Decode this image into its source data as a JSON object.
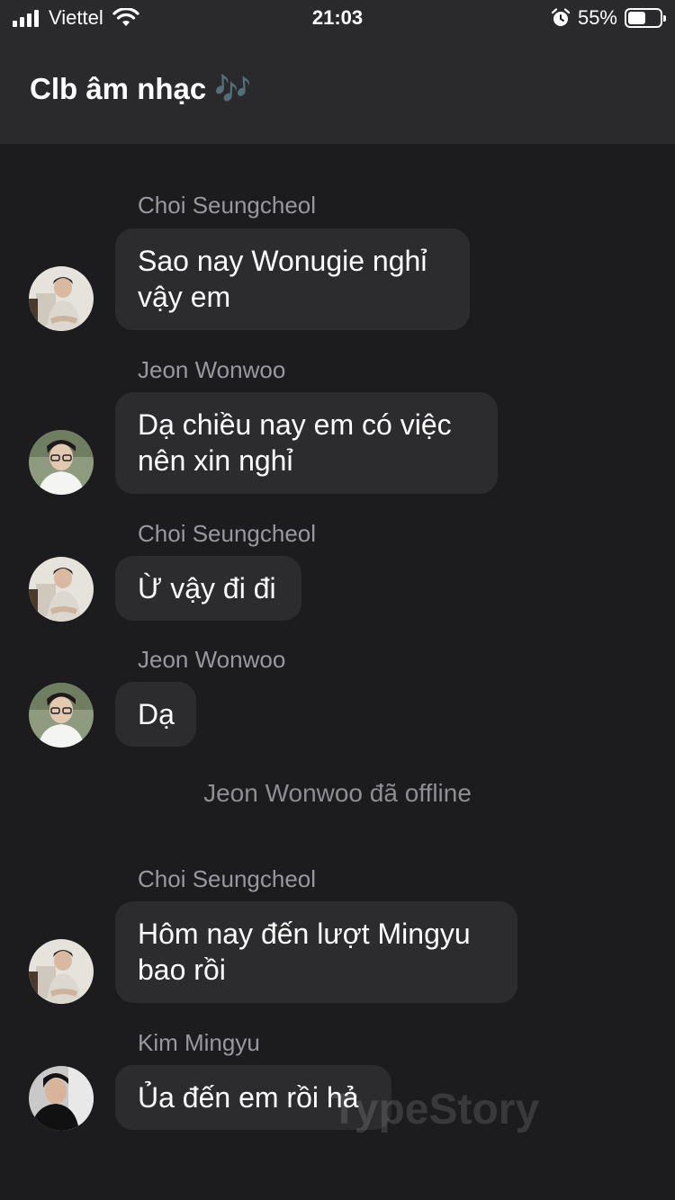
{
  "status_bar": {
    "carrier": "Viettel",
    "time": "21:03",
    "battery_percent": "55%",
    "battery_level": 0.55,
    "icons": [
      "signal-icon",
      "wifi-icon",
      "alarm-icon",
      "battery-icon"
    ]
  },
  "header": {
    "title": "Clb âm nhạc 🎶"
  },
  "messages": [
    {
      "sender": "Choi Seungcheol",
      "text_lines": [
        "Sao nay Wonugie nghỉ",
        "vậy em"
      ]
    },
    {
      "sender": "Jeon Wonwoo",
      "text_lines": [
        "Dạ chiều nay em có việc",
        "nên xin nghỉ"
      ]
    },
    {
      "sender": "Choi Seungcheol",
      "text_lines": [
        "Ừ vậy đi đi"
      ]
    },
    {
      "sender": "Jeon Wonwoo",
      "text_lines": [
        "Dạ"
      ]
    },
    {
      "sender": "Choi Seungcheol",
      "text_lines": [
        "Hôm nay đến lượt Mingyu",
        "bao rồi"
      ]
    },
    {
      "sender": "Kim Mingyu",
      "text_lines": [
        "Ủa đến em rồi hả"
      ]
    }
  ],
  "system_message": "Jeon Wonwoo đã offline",
  "watermark": "TypeStory",
  "colors": {
    "background": "#1c1c1e",
    "header": "#2a2a2c",
    "bubble": "#2c2c2e",
    "sender_name": "#98989e"
  }
}
